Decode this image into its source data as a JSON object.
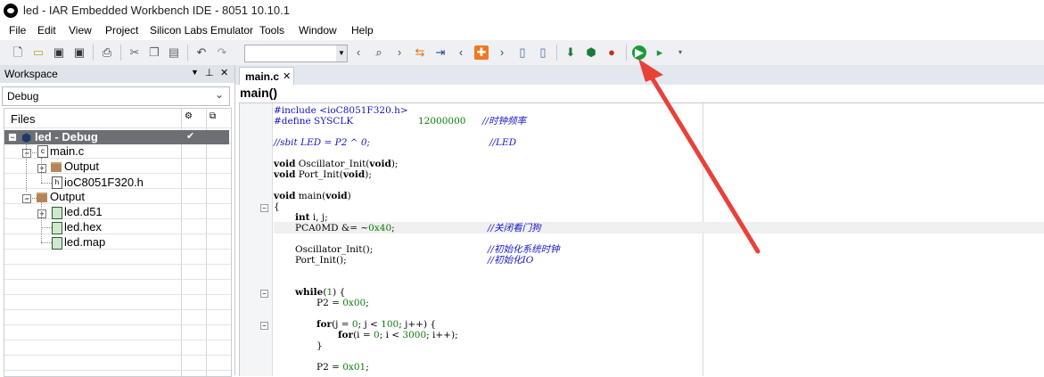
{
  "window": {
    "title": "led - IAR Embedded Workbench IDE - 8051 10.10.1"
  },
  "menu": [
    "File",
    "Edit",
    "View",
    "Project",
    "Silicon Labs Emulator",
    "Tools",
    "Window",
    "Help"
  ],
  "toolbar": {
    "icons": [
      "new-file-icon",
      "open-icon",
      "save-icon",
      "save-all-icon",
      "print-icon",
      "cut-icon",
      "copy-icon",
      "paste-icon",
      "undo-icon",
      "redo-icon",
      "find-combo",
      "back-icon",
      "find-icon",
      "forward-icon",
      "toggle-bookmark-icon",
      "go-to-line-icon",
      "prev-bookmark-icon",
      "breakpoint-icon",
      "next-bookmark-icon",
      "bookmark-list-icon",
      "compile-icon",
      "make-icon",
      "stop-build-icon",
      "debug-icon",
      "download-icon",
      "run-icon"
    ],
    "combo_value": ""
  },
  "workspace": {
    "title": "Workspace",
    "config": "Debug",
    "files_header": "Files",
    "tree": [
      {
        "label": "led - Debug",
        "type": "project"
      },
      {
        "label": "main.c",
        "type": "cfile"
      },
      {
        "label": "Output",
        "type": "folder"
      },
      {
        "label": "ioC8051F320.h",
        "type": "hfile"
      },
      {
        "label": "Output",
        "type": "folder"
      },
      {
        "label": "led.d51",
        "type": "file"
      },
      {
        "label": "led.hex",
        "type": "file"
      },
      {
        "label": "led.map",
        "type": "file"
      }
    ]
  },
  "editor": {
    "tab": "main.c",
    "function": "main()",
    "lines": {
      "l1": "#include <ioC8051F320.h>",
      "l2a": "#define SYSCLK",
      "l2b": "12000000",
      "l2c": "//时钟频率",
      "l3a": "//sbit LED = P2 ^ 0;",
      "l3b": "//LED",
      "l4a": "void",
      "l4b": " Oscillator_Init(",
      "l4c": "void",
      "l4d": ");",
      "l5a": "void",
      "l5b": " Port_Init(",
      "l5c": "void",
      "l5d": ");",
      "l6a": "void",
      "l6b": " main(",
      "l6c": "void",
      "l6d": ")",
      "l7": "{",
      "l8a": "int",
      "l8b": " i, j;",
      "l9a": "PCA0MD &= ~",
      "l9b": "0x40",
      "l9c": ";",
      "l9d": "//关闭看门狗",
      "l10a": "Oscillator_Init();",
      "l10b": "//初始化系统时钟",
      "l11a": "Port_Init();",
      "l11b": "//初始化IO",
      "l12a": "while",
      "l12b": "(",
      "l12c": "1",
      "l12d": ") {",
      "l13a": "P2 = ",
      "l13b": "0x00",
      "l13c": ";",
      "l14a": "for",
      "l14b": "(j = ",
      "l14c": "0",
      "l14d": "; j < ",
      "l14e": "100",
      "l14f": "; j++) {",
      "l15a": "for",
      "l15b": "(i = ",
      "l15c": "0",
      "l15d": "; i < ",
      "l15e": "3000",
      "l15f": "; i++);",
      "l16": "}",
      "l17a": "P2 = ",
      "l17b": "0x01",
      "l17c": ";"
    }
  },
  "colors": {
    "toolbar_bg": "#eef0f4",
    "annotation_arrow": "#e8413a",
    "keyword": "#000000",
    "number": "#0a7b0a",
    "comment": "#1414c8"
  }
}
